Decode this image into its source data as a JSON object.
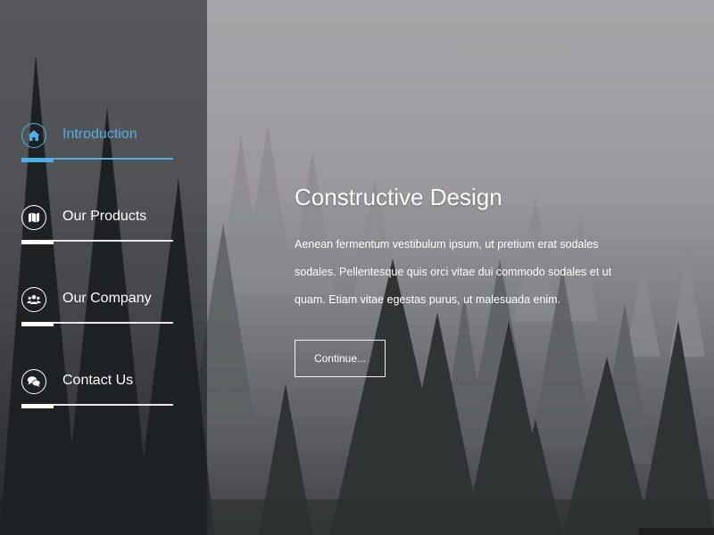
{
  "nav": {
    "items": [
      {
        "label": "Introduction",
        "icon": "home-icon",
        "active": true
      },
      {
        "label": "Our Products",
        "icon": "map-icon",
        "active": false
      },
      {
        "label": "Our Company",
        "icon": "users-icon",
        "active": false
      },
      {
        "label": "Contact Us",
        "icon": "chat-icon",
        "active": false
      }
    ]
  },
  "main": {
    "title": "Constructive Design",
    "body": "Aenean fermentum vestibulum ipsum, ut pretium erat sodales sodales. Pellentesque quis orci vitae dui commodo sodales et ut quam. Etiam vitae egestas purus, ut malesuada enim.",
    "button_label": "Continue..."
  },
  "colors": {
    "accent": "#4fb0e4",
    "text": "#ffffff"
  }
}
